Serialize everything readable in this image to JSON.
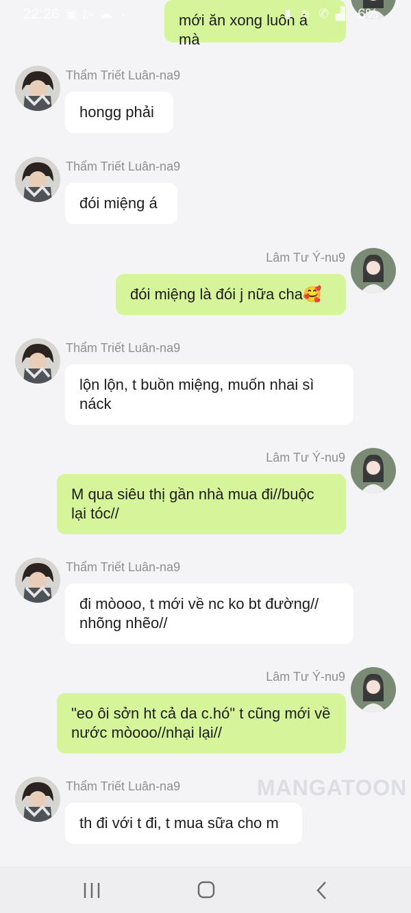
{
  "status_bar": {
    "time": "22:26",
    "battery": "6%"
  },
  "messages": [
    {
      "side": "right",
      "sender": "",
      "text": "mới ăn xong luôn á mà"
    },
    {
      "side": "left",
      "sender": "Thẩm Triết Luân-na9",
      "text": "hongg phải"
    },
    {
      "side": "left",
      "sender": "Thẩm Triết Luân-na9",
      "text": "đói miệng á"
    },
    {
      "side": "right",
      "sender": "Lâm Tư Ý-nu9",
      "text": "đói miệng là đói j nữa cha🥰"
    },
    {
      "side": "left",
      "sender": "Thẩm Triết Luân-na9",
      "text": "lộn lộn, t buồn miệng, muốn nhai sì náck"
    },
    {
      "side": "right",
      "sender": "Lâm Tư Ý-nu9",
      "text": "M qua siêu thị gần nhà mua đi//buộc lại tóc//"
    },
    {
      "side": "left",
      "sender": "Thẩm Triết Luân-na9",
      "text": "đi mòooo, t mới về nc ko bt đường// nhõng nhẽo//"
    },
    {
      "side": "right",
      "sender": "Lâm Tư Ý-nu9",
      "text": "\"eo ôi sởn ht cả da c.hó\" t cũng mới về nước mòooo//nhại lại//"
    },
    {
      "side": "left",
      "sender": "Thẩm Triết Luân-na9",
      "text": "th đi với t đi, t mua sữa cho m"
    }
  ],
  "watermark": "MANGATOON",
  "colors": {
    "background": "#f4f4f6",
    "incoming_bubble": "#ffffff",
    "outgoing_bubble": "#d6f59a",
    "sender_name": "#8e8e93"
  },
  "icons": {
    "nav": [
      "recent-apps-icon",
      "home-icon",
      "back-icon"
    ]
  }
}
